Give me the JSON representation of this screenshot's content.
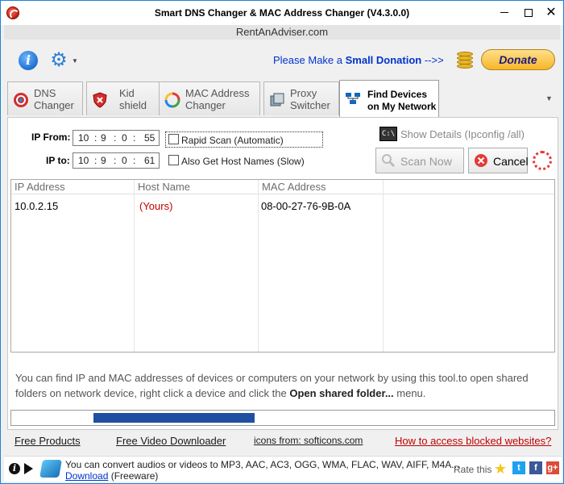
{
  "window": {
    "title": "Smart DNS Changer & MAC Address Changer (V4.3.0.0)",
    "minimize_label": "",
    "close_label": "✕"
  },
  "banner": {
    "link": "RentAnAdviser.com"
  },
  "toolbar": {
    "donate_text_prefix": "Please Make a ",
    "donate_text_bold": "Small Donation",
    "donate_text_suffix": " -->>",
    "donate_button": "Donate"
  },
  "tabs": [
    {
      "line1": "DNS",
      "line2": "Changer",
      "icon": "dns-globe-icon"
    },
    {
      "line1": "Kid",
      "line2": "shield",
      "icon": "shield-icon"
    },
    {
      "line1": "MAC Address",
      "line2": "Changer",
      "icon": "mac-refresh-icon"
    },
    {
      "line1": "Proxy",
      "line2": "Switcher",
      "icon": "proxy-icon"
    },
    {
      "line1": "Find Devices",
      "line2": "on My Network",
      "icon": "network-icon",
      "active": true
    }
  ],
  "scan": {
    "ip_from_label": "IP From:",
    "ip_to_label": "IP to:",
    "ip_from": [
      "10",
      "9",
      "0",
      "55"
    ],
    "ip_to": [
      "10",
      "9",
      "0",
      "61"
    ],
    "rapid_scan_label": "Rapid Scan (Automatic)",
    "host_names_label": "Also Get Host Names (Slow)",
    "show_details_label": "Show Details (Ipconfig /all)",
    "scan_now_label": "Scan Now",
    "cancel_label": "Cancel"
  },
  "table": {
    "columns": [
      "IP Address",
      "Host Name",
      "MAC Address"
    ],
    "rows": [
      {
        "ip": "10.0.2.15",
        "host": "(Yours)",
        "mac": "08-00-27-76-9B-0A"
      }
    ]
  },
  "description": {
    "part1": "You can find IP and MAC addresses of devices or computers on your network by using this tool.to open shared folders on network device, right click a device and click the ",
    "bold": "Open shared folder...",
    "part2": " menu."
  },
  "progress": {
    "fill_start": 0.152,
    "fill_end": 0.448
  },
  "links": {
    "free_products": "Free Products",
    "free_video": "Free Video Downloader",
    "icons_from": "icons from: softicons.com",
    "blocked": "How to access blocked websites?"
  },
  "footer": {
    "promo_line1": "You can convert audios or videos to MP3, AAC, AC3, OGG, WMA, FLAC, WAV, AIFF, M4A...",
    "promo_download": "Download",
    "promo_suffix": " (Freeware)",
    "rate_label": "Rate this"
  },
  "colors": {
    "accent": "#1883d7",
    "link_red": "#c00000",
    "donate_blue": "#0033cc",
    "progress": "#1f4fa0"
  }
}
